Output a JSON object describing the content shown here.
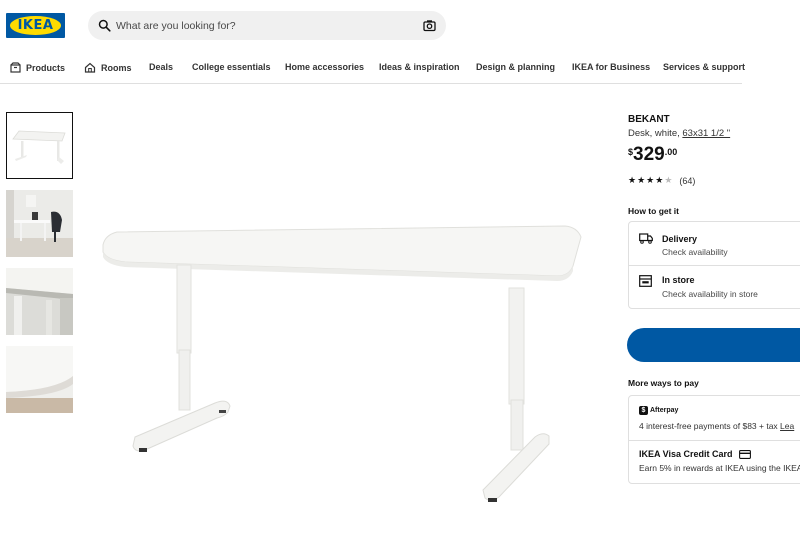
{
  "header": {
    "logo_text": "IKEA",
    "search_placeholder": "What are you looking for?"
  },
  "nav": {
    "items": [
      {
        "label": "Products",
        "icon": "box-icon"
      },
      {
        "label": "Rooms",
        "icon": "house-icon"
      },
      {
        "label": "Deals"
      },
      {
        "label": "College essentials"
      },
      {
        "label": "Home accessories"
      },
      {
        "label": "Ideas & inspiration"
      },
      {
        "label": "Design & planning"
      },
      {
        "label": "IKEA for Business"
      },
      {
        "label": "Services & support"
      }
    ]
  },
  "product": {
    "name": "BEKANT",
    "desc_prefix": "Desk, white, ",
    "size": "63x31 1/2 \"",
    "price_currency": "$",
    "price_int": "329",
    "price_dec": ".00",
    "rating": 4.5,
    "reviews": "(64)"
  },
  "delivery": {
    "heading": "How to get it",
    "delivery_title": "Delivery",
    "delivery_sub": "Check availability",
    "store_title": "In store",
    "store_sub": "Check availability in store"
  },
  "payment": {
    "heading": "More ways to pay",
    "afterpay_badge": "Afterpay",
    "afterpay_text": "4 interest-free payments of $83 + tax ",
    "afterpay_link": "Lea",
    "visa_title": "IKEA Visa Credit Card",
    "visa_text": "Earn 5% in rewards at IKEA using the IKEA"
  },
  "colors": {
    "brand_blue": "#0058a3",
    "brand_yellow": "#ffdb00"
  }
}
